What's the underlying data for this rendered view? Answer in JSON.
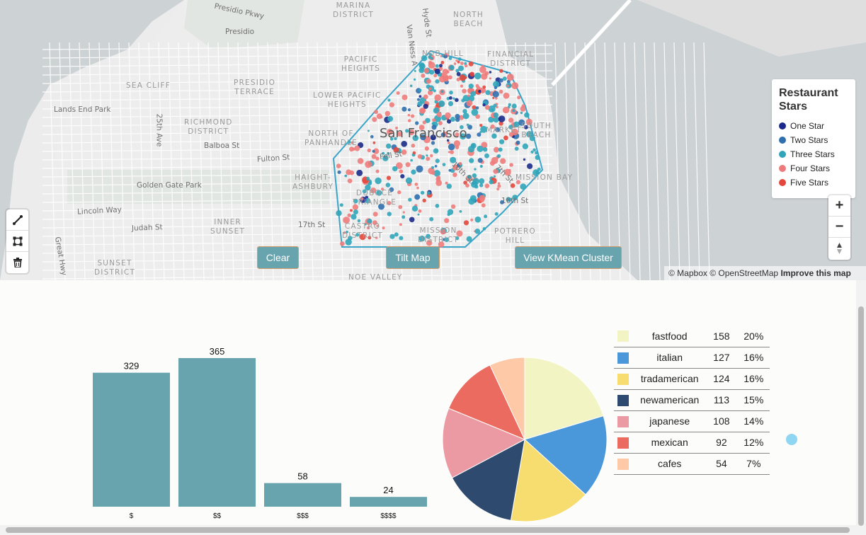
{
  "map": {
    "city_label": "San Francisco",
    "neighborhoods": [
      {
        "text": "MARINA\nDISTRICT"
      },
      {
        "text": "NORTH\nBEACH"
      },
      {
        "text": "PACIFIC\nHEIGHTS"
      },
      {
        "text": "FINANCIAL\nDISTRICT"
      },
      {
        "text": "SEA CLIFF"
      },
      {
        "text": "PRESIDIO\nTERRACE"
      },
      {
        "text": "LOWER PACIFIC\nHEIGHTS"
      },
      {
        "text": "RICHMOND\nDISTRICT"
      },
      {
        "text": "NORTH OF\nPANHANDLE"
      },
      {
        "text": "HAIGHT-\nASHBURY"
      },
      {
        "text": "DUBOCE\nTRIANGLE"
      },
      {
        "text": "INNER\nSUNSET"
      },
      {
        "text": "CASTRO\nDISTRICT"
      },
      {
        "text": "MISSION\nDISTRICT"
      },
      {
        "text": "POTRERO\nHILL"
      },
      {
        "text": "SUNSET\nDISTRICT"
      },
      {
        "text": "NOE VALLEY"
      },
      {
        "text": "MISSION BAY"
      },
      {
        "text": "SOUTH\nBEACH"
      },
      {
        "text": "NOB HILL"
      },
      {
        "text": "MARKET"
      }
    ],
    "streets": [
      {
        "text": "Presidio Pkwy"
      },
      {
        "text": "Presidio"
      },
      {
        "text": "Lands End Park"
      },
      {
        "text": "Balboa St"
      },
      {
        "text": "Fulton St"
      },
      {
        "text": "Golden Gate Park"
      },
      {
        "text": "Lincoln Way"
      },
      {
        "text": "Judah St"
      },
      {
        "text": "17th St"
      },
      {
        "text": "Fell St"
      },
      {
        "text": "16th St"
      },
      {
        "text": "10th St"
      },
      {
        "text": "7th St"
      },
      {
        "text": "25th Ave"
      },
      {
        "text": "Great Hwy"
      },
      {
        "text": "Van Ness A"
      },
      {
        "text": "Hyde St"
      }
    ],
    "legend": {
      "title": "Restaurant Stars",
      "items": [
        {
          "label": "One Star",
          "color": "#1b2a8a"
        },
        {
          "label": "Two Stars",
          "color": "#2f6fae"
        },
        {
          "label": "Three Stars",
          "color": "#30a5ba"
        },
        {
          "label": "Four Stars",
          "color": "#ee7b7b"
        },
        {
          "label": "Five Stars",
          "color": "#e3473c"
        }
      ]
    },
    "buttons": {
      "clear": "Clear",
      "tilt": "Tilt Map",
      "kmean": "View KMean Cluster"
    },
    "nav": {
      "zoom_in": "+",
      "zoom_out": "−",
      "compass": "▲"
    },
    "attribution": {
      "mapbox": "© Mapbox",
      "osm": "© OpenStreetMap",
      "improve": "Improve this map"
    },
    "draw_tools": [
      "line-tool-icon",
      "polygon-tool-icon",
      "trash-icon"
    ]
  },
  "chart_data": [
    {
      "type": "bar",
      "categories": [
        "$",
        "$$",
        "$$$",
        "$$$$"
      ],
      "values": [
        329,
        365,
        58,
        24
      ],
      "ylim": [
        0,
        365
      ],
      "color": "#68a4ae",
      "title": "",
      "xlabel": "",
      "ylabel": ""
    },
    {
      "type": "pie",
      "categories": [
        "fastfood",
        "italian",
        "tradamerican",
        "newamerican",
        "japanese",
        "mexican",
        "cafes"
      ],
      "values": [
        158,
        127,
        124,
        113,
        108,
        92,
        54
      ],
      "percents": [
        "20%",
        "16%",
        "16%",
        "15%",
        "14%",
        "12%",
        "7%"
      ],
      "colors": [
        "#f2f4c3",
        "#4a98d9",
        "#f7dc6f",
        "#2e4a6e",
        "#eb9aa3",
        "#ec6b60",
        "#fdc9a6"
      ]
    }
  ]
}
